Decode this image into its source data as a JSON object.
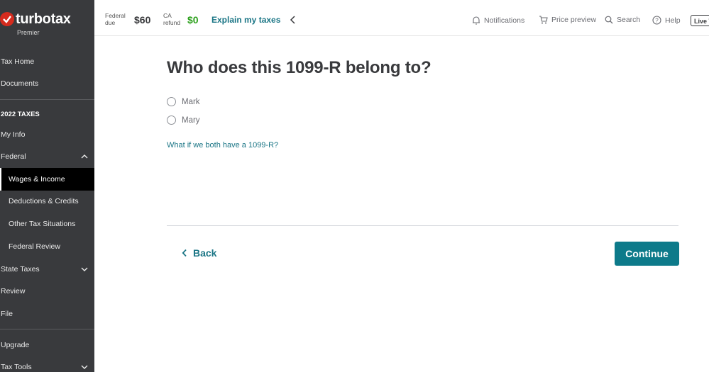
{
  "brand": {
    "name": "turbotax",
    "edition": "Premier"
  },
  "sidebar": {
    "items": [
      {
        "label": "Tax Home"
      },
      {
        "label": "Documents"
      },
      {
        "label": "2022 TAXES"
      },
      {
        "label": "My Info"
      },
      {
        "label": "Federal"
      },
      {
        "label": "Wages & Income"
      },
      {
        "label": "Deductions & Credits"
      },
      {
        "label": "Other Tax Situations"
      },
      {
        "label": "Federal Review"
      },
      {
        "label": "State Taxes"
      },
      {
        "label": "Review"
      },
      {
        "label": "File"
      },
      {
        "label": "Upgrade"
      },
      {
        "label": "Tax Tools"
      }
    ]
  },
  "topbar": {
    "federal_label_1": "Federal",
    "federal_label_2": "due",
    "federal_amount": "$60",
    "ca_label_1": "CA",
    "ca_label_2": "refund",
    "ca_amount": "$0",
    "explain": "Explain my taxes",
    "notifications": "Notifications",
    "price_preview": "Price preview",
    "search": "Search",
    "help": "Help",
    "live": "Live T"
  },
  "main": {
    "title": "Who does this 1099-R belong to?",
    "options": [
      {
        "label": "Mark"
      },
      {
        "label": "Mary"
      }
    ],
    "help_link": "What if we both have a 1099-R?",
    "back": "Back",
    "continue": "Continue"
  },
  "colors": {
    "sidebar_bg": "#393a3d",
    "accent_teal": "#0d7a8a",
    "federal_amount": "#393a3d",
    "ca_amount": "#2ca01c",
    "brand_red": "#d52b1e"
  }
}
